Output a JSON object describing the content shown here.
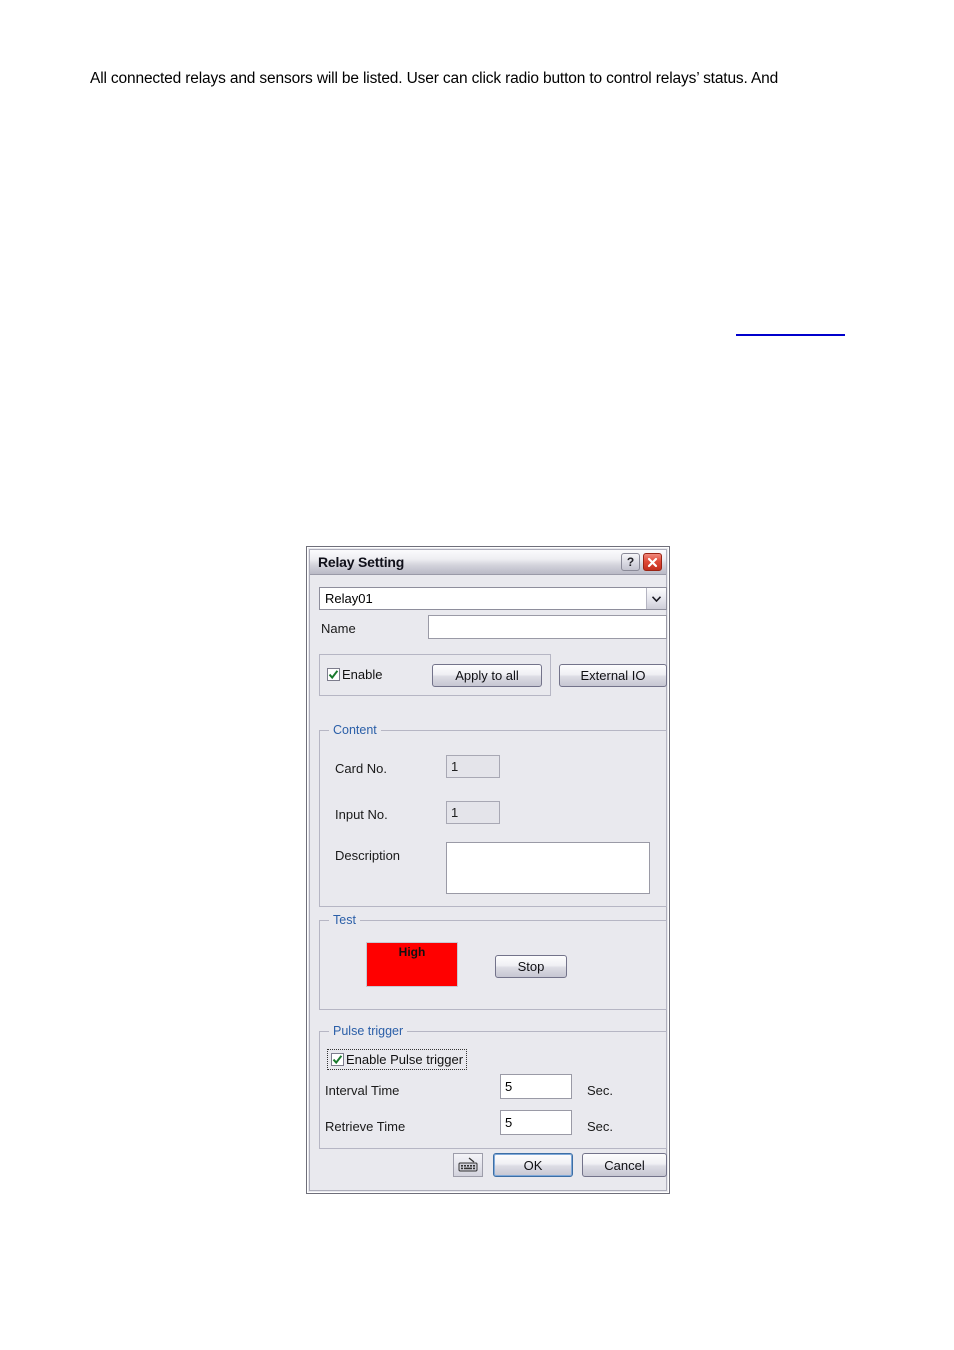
{
  "document": {
    "paragraph": "All connected relays and sensors will be listed. User can click radio button to control relays’ status. And"
  },
  "dialog": {
    "title": "Relay Setting",
    "titlebar_buttons": {
      "help": "?",
      "close": "✕"
    },
    "relay_select": {
      "value": "Relay01",
      "options": [
        "Relay01"
      ]
    },
    "name_field": {
      "label": "Name",
      "value": "",
      "placeholder": ""
    },
    "enable_group": {
      "enable_checkbox": {
        "label": "Enable",
        "checked": true
      },
      "apply_to_all_label": "Apply to all",
      "external_io_label": "External IO"
    },
    "content_group": {
      "title": "Content",
      "card_no": {
        "label": "Card No.",
        "value": "1"
      },
      "input_no": {
        "label": "Input No.",
        "value": "1"
      },
      "description": {
        "label": "Description",
        "value": ""
      }
    },
    "test_group": {
      "title": "Test",
      "status_label": "High",
      "status_color": "#ff0000",
      "stop_label": "Stop"
    },
    "pulse_group": {
      "title": "Pulse trigger",
      "enable_checkbox": {
        "label": "Enable Pulse trigger",
        "checked": true
      },
      "interval": {
        "label": "Interval Time",
        "value": "5",
        "unit": "Sec."
      },
      "retrieve": {
        "label": "Retrieve Time",
        "value": "5",
        "unit": "Sec."
      }
    },
    "footer": {
      "keyboard_icon": "onscreen-keyboard-icon",
      "ok_label": "OK",
      "cancel_label": "Cancel"
    }
  }
}
